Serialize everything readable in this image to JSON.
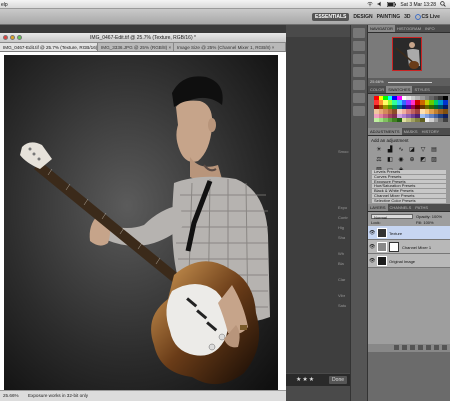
{
  "menubar": {
    "app_menu": "elp",
    "datetime": "Sat 3 Mar  13:28",
    "search_icon": "magnifier-icon"
  },
  "appbar": {
    "workspaces": [
      "ESSENTIALS",
      "DESIGN",
      "PAINTING",
      "3D"
    ],
    "cs_live": "CS Live"
  },
  "document": {
    "title": "IMG_0467-Edit.tif @ 25.7% (Texture, RGB/16) *",
    "tabs": [
      "IMG_0467-Edit.tif @ 25.7% (Texture, RGB/16) *",
      "IMG_3336.JPG @ 25% (RGB/8) ×",
      "Image Size @ 25% (Channel Mixer 1, RGB/8) ×"
    ],
    "status_zoom": "25.66%",
    "status_message": "Exposure works in 32-bit only"
  },
  "middle": {
    "stars": "★★★",
    "done_label": "Done",
    "prev_label": "Prev",
    "side_labels": [
      "Smoo",
      "Expo",
      "Contr",
      "Hig",
      "Sha",
      "Wh",
      "Bla",
      "Clar",
      "Vibr",
      "Satu"
    ]
  },
  "panels": {
    "navigator": {
      "tabs": [
        "NAVIGATOR",
        "HISTOGRAM",
        "INFO"
      ],
      "zoom": "25.66%"
    },
    "swatches": {
      "tabs": [
        "COLOR",
        "SWATCHES",
        "STYLES"
      ],
      "colors": [
        "#ff0000",
        "#ffff00",
        "#00ff00",
        "#00ffff",
        "#0000ff",
        "#ff00ff",
        "#ffffff",
        "#e6e6e6",
        "#cccccc",
        "#b3b3b3",
        "#999999",
        "#808080",
        "#666666",
        "#4d4d4d",
        "#333333",
        "#000000",
        "#ff3333",
        "#ff9933",
        "#ffff66",
        "#99ff33",
        "#33ff99",
        "#33ccff",
        "#3366ff",
        "#9933ff",
        "#ff33cc",
        "#cc0000",
        "#cc6600",
        "#cccc00",
        "#66cc00",
        "#00cc66",
        "#0099cc",
        "#0033cc",
        "#990000",
        "#994c00",
        "#999900",
        "#4c9900",
        "#00994c",
        "#007399",
        "#002699",
        "#4c0099",
        "#99004c",
        "#660000",
        "#663300",
        "#666600",
        "#336600",
        "#006633",
        "#004c66",
        "#001a66",
        "#f2c6a0",
        "#e8a878",
        "#d48a5a",
        "#b86c40",
        "#8c4c28",
        "#f4d0c0",
        "#f0b0a0",
        "#d88080",
        "#c06060",
        "#a04040",
        "#fce0b0",
        "#f8c880",
        "#e0a050",
        "#c08030",
        "#a06020",
        "#805010",
        "#f0a0c0",
        "#e080a0",
        "#c06080",
        "#a04060",
        "#803050",
        "#d0a0e0",
        "#b080d0",
        "#9060b0",
        "#704090",
        "#502070",
        "#a0c0f0",
        "#80a0e0",
        "#6080c0",
        "#4060a0",
        "#204080",
        "#102060",
        "#c0f0a0",
        "#a0e080",
        "#80c060",
        "#60a040",
        "#408020",
        "#206010",
        "#e0e0a0",
        "#c0c080",
        "#a0a060",
        "#808040",
        "#606020",
        "#f0f0f0",
        "#d0d0d0",
        "#a0a0a0",
        "#707070",
        "#404040"
      ]
    },
    "adjustments": {
      "tabs": [
        "ADJUSTMENTS",
        "MASKS",
        "HISTORY"
      ],
      "title": "Add an adjustment",
      "icons": [
        "brightness-icon",
        "levels-icon",
        "curves-icon",
        "exposure-icon",
        "vibrance-icon",
        "hue-sat-icon",
        "color-balance-icon",
        "bw-icon",
        "photo-filter-icon",
        "channel-mixer-icon",
        "invert-icon",
        "posterize-icon",
        "threshold-icon",
        "gradient-map-icon",
        "selective-color-icon"
      ],
      "presets": [
        "Levels Presets",
        "Curves Presets",
        "Exposure Presets",
        "Hue/Saturation Presets",
        "Black & White Presets",
        "Channel Mixer Presets",
        "Selective Color Presets"
      ]
    },
    "layers": {
      "tabs": [
        "LAYERS",
        "CHANNELS",
        "PATHS"
      ],
      "blend_mode": "Normal",
      "opacity_label": "Opacity:",
      "opacity": "100%",
      "lock_label": "Lock:",
      "fill_label": "Fill:",
      "fill": "100%",
      "items": [
        {
          "name": "Texture",
          "selected": true
        },
        {
          "name": "Channel Mixer 1",
          "selected": false
        },
        {
          "name": "Original Image",
          "selected": false
        }
      ]
    }
  }
}
